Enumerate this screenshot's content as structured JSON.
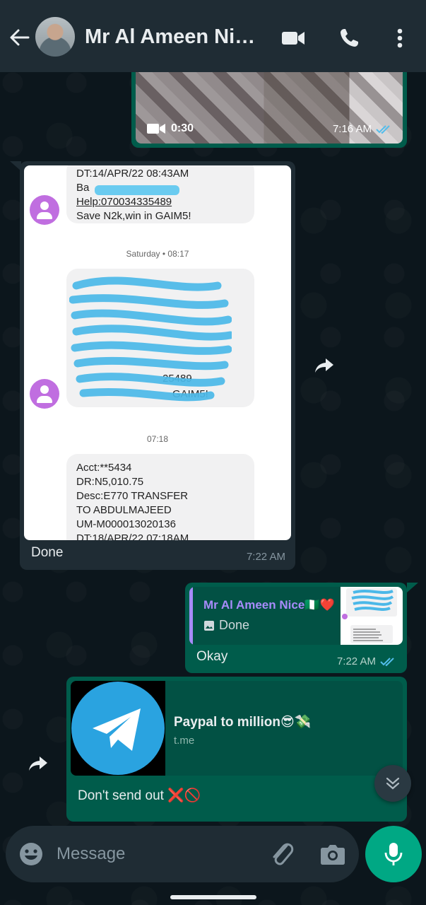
{
  "header": {
    "contact_name": "Mr Al Ameen Nic…",
    "icons": [
      "back-arrow-icon",
      "video-call-icon",
      "phone-icon",
      "more-vert-icon"
    ]
  },
  "video_message": {
    "duration": "0:30",
    "time": "7:16 AM"
  },
  "image_message": {
    "sms_block_1": [
      "DT:14/APR/22 08:43AM",
      "Ba",
      "Help:070034335489",
      "Save N2k,win in GAIM5!"
    ],
    "date_separator_1": "Saturday • 08:17",
    "sms_block_2_tail": "GAIM5!",
    "sms_block_2_partial": "25489",
    "date_separator_2": "07:18",
    "sms_block_3": [
      "Acct:**5434",
      "DR:N5,010.75",
      "Desc:E770 TRANSFER",
      "TO ABDULMAJEED",
      "UM-M000013020136",
      "DT:18/APR/22 07:18AM"
    ],
    "caption": "Done",
    "time": "7:22 AM"
  },
  "reply_message": {
    "quoted_name": "Mr Al Ameen Nice🇳🇬❤️",
    "quoted_text": "Done",
    "text": "Okay",
    "time": "7:22 AM"
  },
  "link_message": {
    "title": "Paypal to million😎💸",
    "domain": "t.me",
    "caption": "Don't send out ❌🚫"
  },
  "input": {
    "placeholder": "Message"
  },
  "colors": {
    "header_bg": "#1f2c34",
    "outgoing_bubble": "#005c4b",
    "incoming_bubble": "#1f2c34",
    "accent_green": "#00a884",
    "read_ticks": "#53bdeb"
  }
}
